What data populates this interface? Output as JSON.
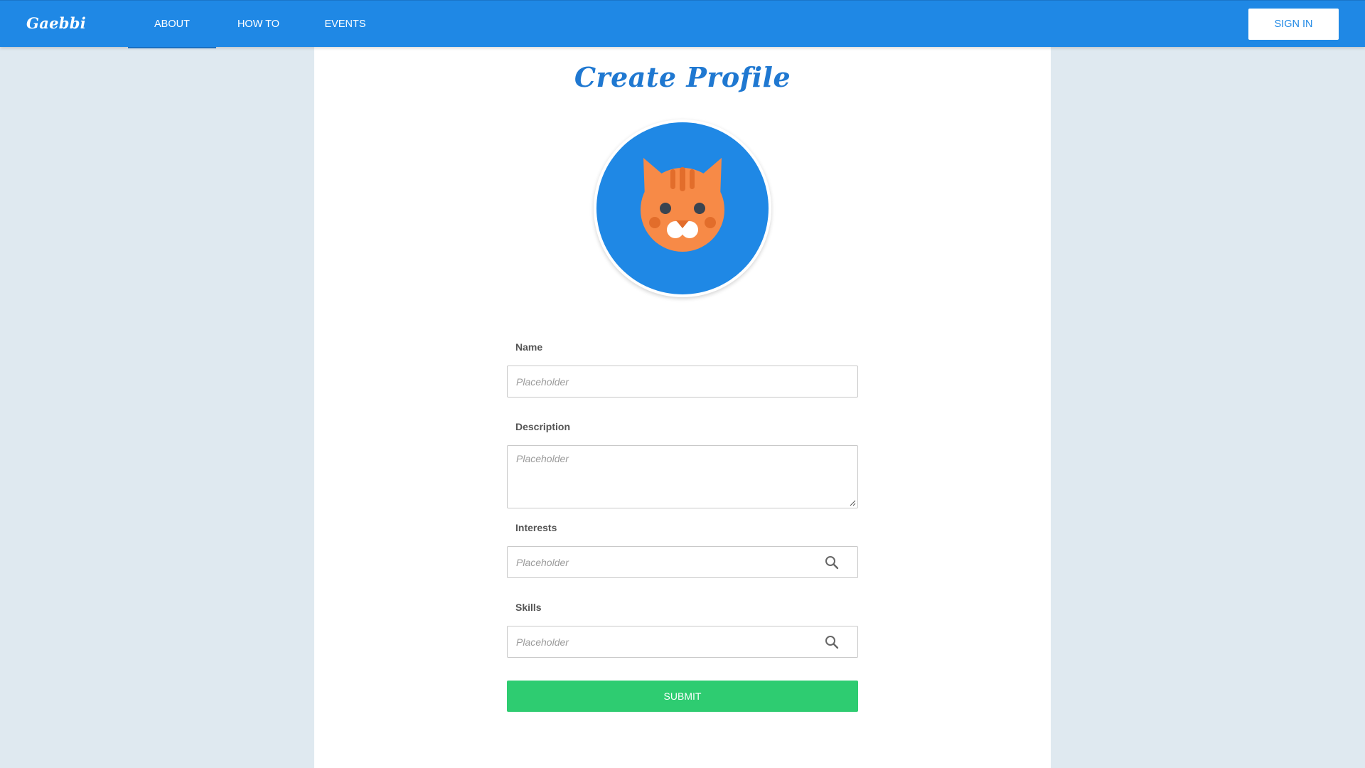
{
  "nav": {
    "logo": "Gaebbi",
    "items": [
      "ABOUT",
      "HOW TO",
      "EVENTS"
    ],
    "signin_label": "SIGN IN"
  },
  "page": {
    "title": "Create Profile"
  },
  "form": {
    "name": {
      "label": "Name",
      "placeholder": "Placeholder"
    },
    "description": {
      "label": "Description",
      "placeholder": "Placeholder"
    },
    "interests": {
      "label": "Interests",
      "placeholder": "Placeholder"
    },
    "skills": {
      "label": "Skills",
      "placeholder": "Placeholder"
    },
    "submit_label": "SUBMIT"
  },
  "icons": {
    "avatar": "cat-face-icon",
    "search": "search-icon"
  },
  "colors": {
    "brand_blue": "#1f88e5",
    "title_blue": "#1f78d1",
    "submit_green": "#2ecc71",
    "cat_orange": "#f78a47"
  }
}
